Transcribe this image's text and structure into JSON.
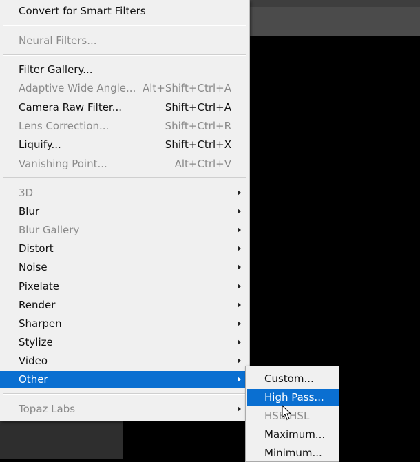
{
  "menu": {
    "convert": "Convert for Smart Filters",
    "neural": "Neural Filters...",
    "items_group1": [
      {
        "label": "Filter Gallery...",
        "shortcut": "",
        "disabled": false
      },
      {
        "label": "Adaptive Wide Angle...",
        "shortcut": "Alt+Shift+Ctrl+A",
        "disabled": true
      },
      {
        "label": "Camera Raw Filter...",
        "shortcut": "Shift+Ctrl+A",
        "disabled": false
      },
      {
        "label": "Lens Correction...",
        "shortcut": "Shift+Ctrl+R",
        "disabled": true
      },
      {
        "label": "Liquify...",
        "shortcut": "Shift+Ctrl+X",
        "disabled": false
      },
      {
        "label": "Vanishing Point...",
        "shortcut": "Alt+Ctrl+V",
        "disabled": true
      }
    ],
    "submenus": [
      {
        "label": "3D",
        "disabled": true
      },
      {
        "label": "Blur",
        "disabled": false
      },
      {
        "label": "Blur Gallery",
        "disabled": true
      },
      {
        "label": "Distort",
        "disabled": false
      },
      {
        "label": "Noise",
        "disabled": false
      },
      {
        "label": "Pixelate",
        "disabled": false
      },
      {
        "label": "Render",
        "disabled": false
      },
      {
        "label": "Sharpen",
        "disabled": false
      },
      {
        "label": "Stylize",
        "disabled": false
      },
      {
        "label": "Video",
        "disabled": false
      },
      {
        "label": "Other",
        "disabled": false,
        "selected": true
      }
    ],
    "topaz": "Topaz Labs"
  },
  "other_submenu": [
    {
      "label": "Custom...",
      "disabled": false
    },
    {
      "label": "High Pass...",
      "disabled": false,
      "selected": true
    },
    {
      "label": "HSB/HSL",
      "disabled": true
    },
    {
      "label": "Maximum...",
      "disabled": false
    },
    {
      "label": "Minimum...",
      "disabled": false
    }
  ],
  "colors": {
    "highlight": "#0a6fd1",
    "menu_bg": "#f0f0f0"
  }
}
